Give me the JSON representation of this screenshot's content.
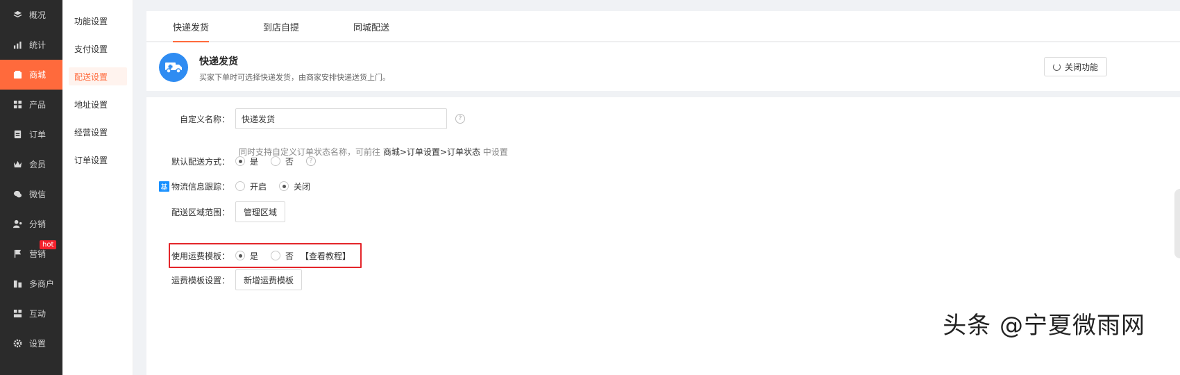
{
  "nav": [
    {
      "label": "概况",
      "icon": "layers-icon"
    },
    {
      "label": "统计",
      "icon": "chart-icon"
    },
    {
      "label": "商城",
      "icon": "shop-icon",
      "active": true
    },
    {
      "label": "产品",
      "icon": "grid-icon"
    },
    {
      "label": "订单",
      "icon": "order-icon"
    },
    {
      "label": "会员",
      "icon": "crown-icon"
    },
    {
      "label": "微信",
      "icon": "wechat-icon"
    },
    {
      "label": "分销",
      "icon": "user-share-icon"
    },
    {
      "label": "营销",
      "icon": "flag-icon",
      "badge": "hot"
    },
    {
      "label": "多商户",
      "icon": "merchant-icon"
    },
    {
      "label": "互动",
      "icon": "interact-icon"
    },
    {
      "label": "设置",
      "icon": "gear-icon"
    }
  ],
  "subnav": [
    {
      "label": "功能设置"
    },
    {
      "label": "支付设置"
    },
    {
      "label": "配送设置",
      "active": true
    },
    {
      "label": "地址设置"
    },
    {
      "label": "经营设置"
    },
    {
      "label": "订单设置"
    }
  ],
  "tabs": [
    {
      "label": "快递发货",
      "active": true
    },
    {
      "label": "到店自提"
    },
    {
      "label": "同城配送"
    }
  ],
  "header": {
    "title": "快递发货",
    "desc": "买家下单时可选择快递发货，由商家安排快递送货上门。",
    "close_label": "关闭功能"
  },
  "form": {
    "custom_name_label": "自定义名称：",
    "custom_name_value": "快递发货",
    "hint_prefix": "同时支持自定义订单状态名称，可前往",
    "hint_path": "商城>订单设置>订单状态",
    "hint_suffix": "中设置",
    "default_label": "默认配送方式：",
    "default_yes": "是",
    "default_no": "否",
    "logistics_badge": "基",
    "logistics_label": "物流信息跟踪：",
    "logistics_on": "开启",
    "logistics_off": "关闭",
    "region_label": "配送区域范围：",
    "region_button": "管理区域",
    "template_label": "使用运费模板：",
    "template_yes": "是",
    "template_no": "否",
    "template_tutorial": "【查看教程】",
    "template_setting_label": "运费模板设置：",
    "template_new_button": "新增运费模板"
  },
  "watermark": "头条 @宁夏微雨网",
  "colors": {
    "accent": "#ff6a3c",
    "nav_bg": "#2b2b2b",
    "highlight": "#e4252a",
    "icon_blue": "#2f8cf2"
  }
}
